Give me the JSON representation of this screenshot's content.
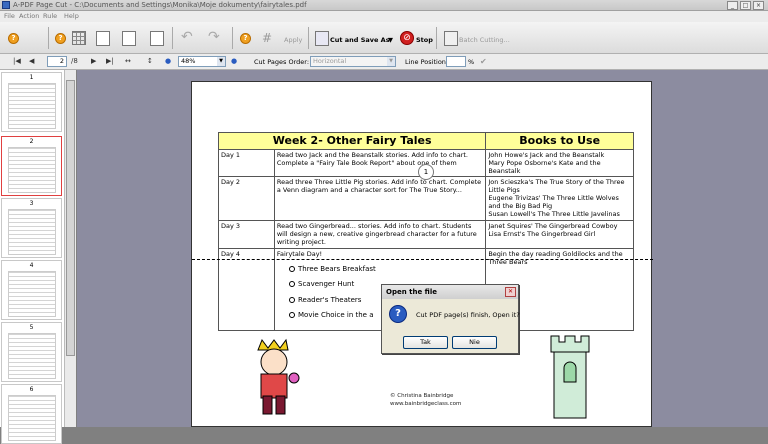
{
  "window": {
    "title": "A-PDF Page Cut - C:\\Documents and Settings\\Monika\\Moje dokumenty\\fairytales.pdf"
  },
  "menu": [
    "File",
    "Action",
    "Rule",
    "Help"
  ],
  "toolbar": {
    "apply_label": "Apply",
    "cut_save_label": "Cut and Save As",
    "stop_label": "Stop",
    "batch_label": "Batch Cutting..."
  },
  "nav": {
    "page": "2",
    "total": "/8",
    "zoom": "48%",
    "cut_order_label": "Cut Pages Order:",
    "cut_order_value": "Horizontal",
    "line_position_label": "Line Position:",
    "line_position_value": "",
    "line_position_unit": "%"
  },
  "thumbnails": [
    "1",
    "2",
    "3",
    "4",
    "5",
    "6"
  ],
  "document": {
    "header_left": "Week 2- Other Fairy Tales",
    "header_right": "Books to Use",
    "rows": [
      {
        "day": "Day 1",
        "activity": "Read two Jack and the Beanstalk stories.  Add info to chart. Complete a \"Fairy Tale Book Report\" about  one of them",
        "books": "John Howe's Jack and the Beanstalk\nMary Pope Osborne's Kate and the Beanstalk"
      },
      {
        "day": "Day 2",
        "activity": "Read three Three Little Pig stories.  Add info to chart. Complete a Venn diagram and a character sort for The True Story...",
        "books": "Jon Scieszka's The True Story of the Three Little Pigs\nEugene Trivizas' The Three Little Wolves and the Big Bad Pig\nSusan Lowell's The Three Little Javelinas"
      },
      {
        "day": "Day 3",
        "activity": "Read two Gingerbread... stories.  Add info to chart. Students will design a new, creative gingerbread character for a future writing project.",
        "books": "Janet  Squires' The Gingerbread Cowboy\nLisa Ernst's The Gingerbread Girl"
      },
      {
        "day": "Day 4",
        "activity": "Fairytale Day!",
        "books": "Begin the day reading Goldilocks and the Three Bears"
      }
    ],
    "bullets": [
      "Three Bears Breakfast",
      "Scavenger Hunt",
      "Reader's Theaters",
      "Movie Choice in the a"
    ],
    "marker": "1",
    "credit1": "© Christina Bainbridge",
    "credit2": "www.bainbridgeclass.com"
  },
  "dialog": {
    "title": "Open the file",
    "message": "Cut PDF page(s) finish, Open it?",
    "yes": "Tak",
    "no": "Nie"
  }
}
